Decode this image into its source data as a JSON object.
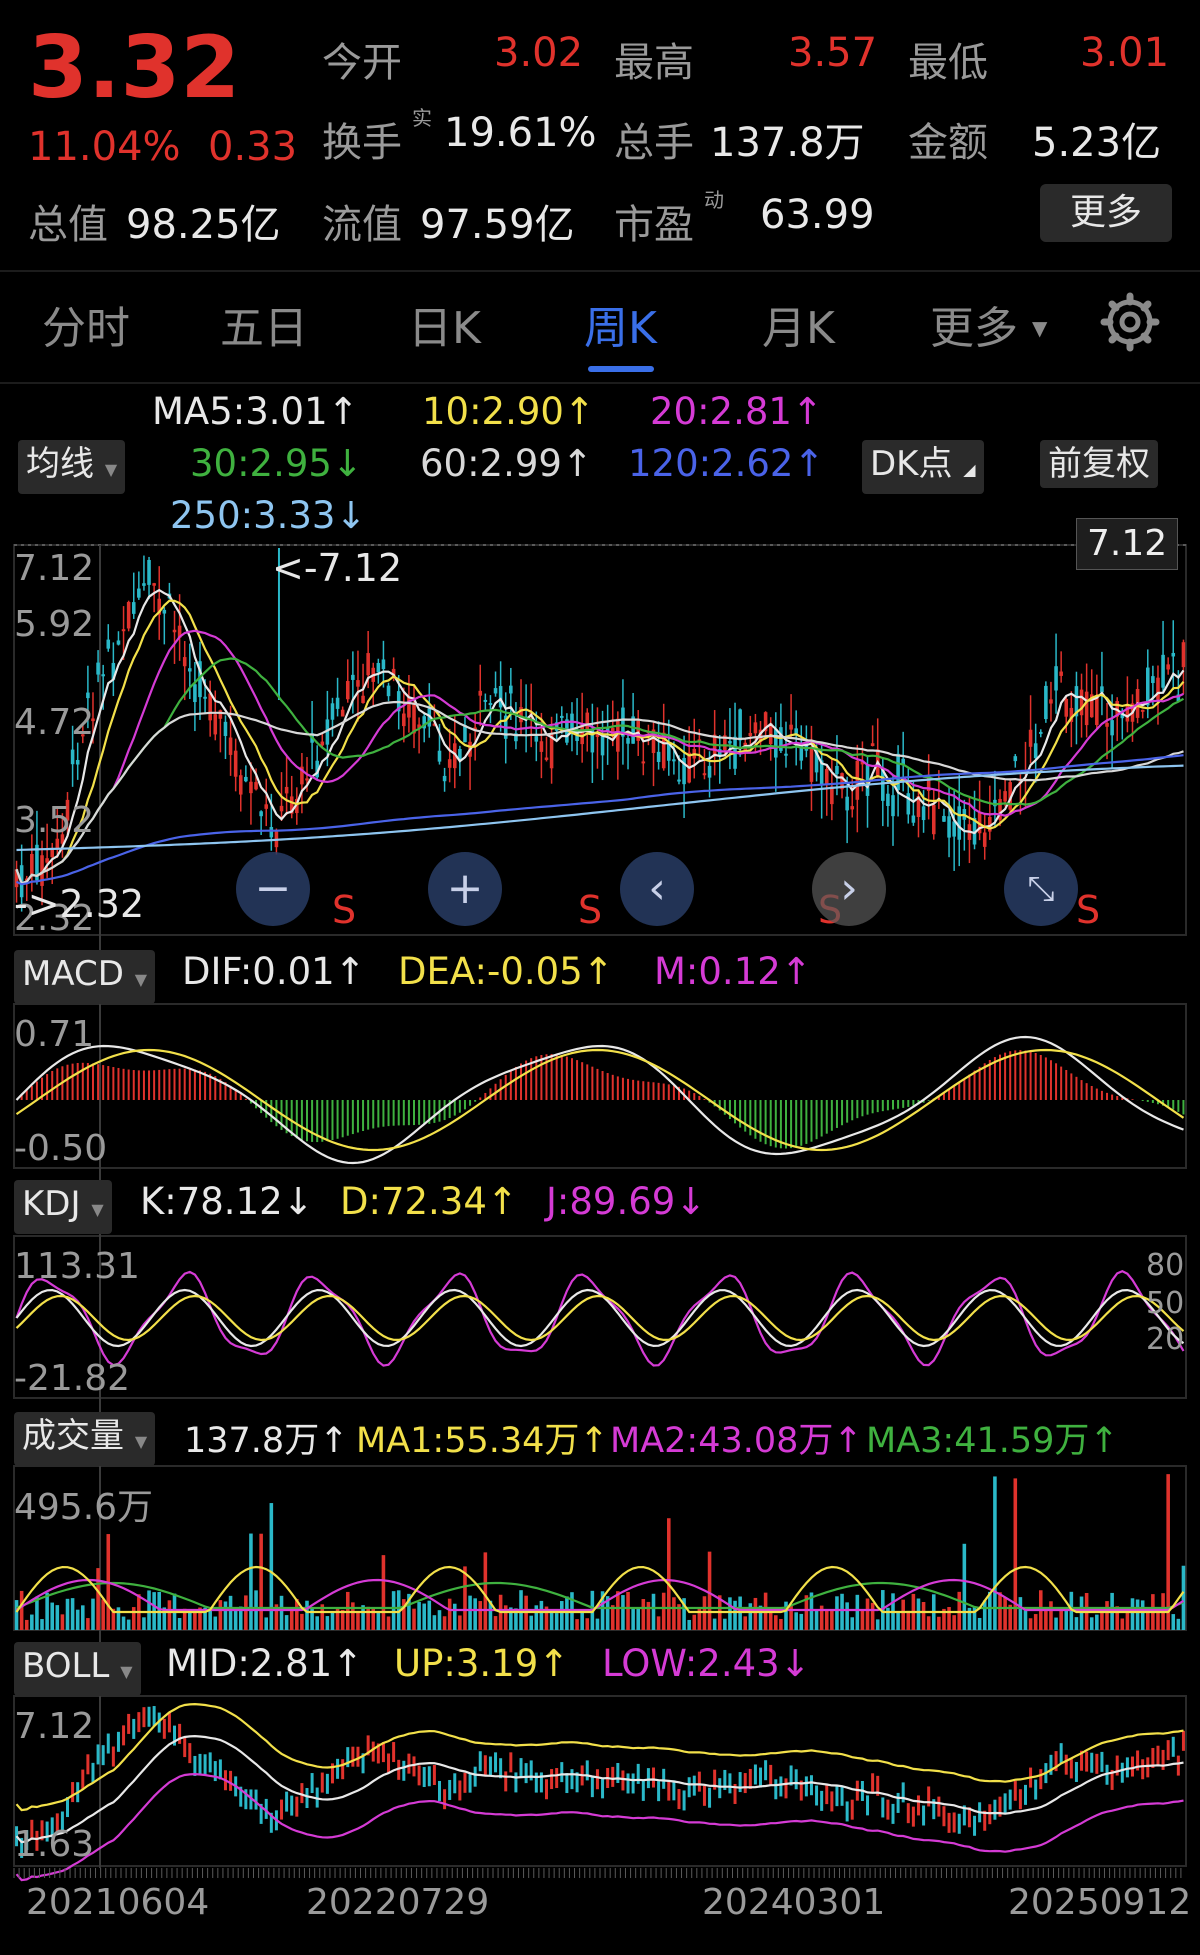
{
  "quote": {
    "price": "3.32",
    "change_pct": "11.04%",
    "change_abs": "0.33",
    "fields": [
      {
        "label": "今开",
        "value": "3.02"
      },
      {
        "label": "最高",
        "value": "3.57"
      },
      {
        "label": "最低",
        "value": "3.01"
      },
      {
        "label": "换手",
        "sup": "实",
        "value": "19.61%"
      },
      {
        "label": "总手",
        "value": "137.8万"
      },
      {
        "label": "金额",
        "value": "5.23亿"
      },
      {
        "label": "总值",
        "value": "98.25亿"
      },
      {
        "label": "流值",
        "value": "97.59亿"
      },
      {
        "label": "市盈",
        "sup": "动",
        "value": "63.99"
      }
    ],
    "more_label": "更多"
  },
  "tabs": [
    "分时",
    "五日",
    "日K",
    "周K",
    "月K",
    "更多"
  ],
  "active_tab": "周K",
  "ma": {
    "selector_label": "均线",
    "dk_label": "DK点",
    "fuquan_label": "前复权",
    "items": [
      {
        "text": "MA5:3.01↑",
        "color": "#e8e8e8"
      },
      {
        "text": "10:2.90↑",
        "color": "#f2e04a"
      },
      {
        "text": "20:2.81↑",
        "color": "#d53bd5"
      },
      {
        "text": "30:2.95↓",
        "color": "#3fb13f"
      },
      {
        "text": "60:2.99↑",
        "color": "#d8d8d8"
      },
      {
        "text": "120:2.62↑",
        "color": "#4a63e8"
      },
      {
        "text": "250:3.33↓",
        "color": "#8ec5f0"
      }
    ]
  },
  "main_chart": {
    "y_labels": [
      "7.12",
      "5.92",
      "4.72",
      "3.52",
      "2.32"
    ],
    "high_flag": "7.12",
    "high_marker": "<-7.12",
    "low_marker": "->2.32",
    "s_marker": "S"
  },
  "macd": {
    "selector_label": "MACD",
    "items": [
      {
        "text": "DIF:0.01↑",
        "color": "#e8e8e8"
      },
      {
        "text": "DEA:-0.05↑",
        "color": "#f2e04a"
      },
      {
        "text": "M:0.12↑",
        "color": "#d53bd5"
      }
    ],
    "y_labels": [
      "0.71",
      "-0.50"
    ]
  },
  "kdj": {
    "selector_label": "KDJ",
    "items": [
      {
        "text": "K:78.12↓",
        "color": "#e8e8e8"
      },
      {
        "text": "D:72.34↑",
        "color": "#f2e04a"
      },
      {
        "text": "J:89.69↓",
        "color": "#d53bd5"
      }
    ],
    "y_labels": [
      "113.31",
      "-21.82"
    ],
    "right_labels": [
      "80",
      "50",
      "20"
    ]
  },
  "volume": {
    "selector_label": "成交量",
    "items": [
      {
        "text": "137.8万↑",
        "color": "#e8e8e8"
      },
      {
        "text": "MA1:55.34万↑",
        "color": "#f2e04a"
      },
      {
        "text": "MA2:43.08万↑",
        "color": "#d53bd5"
      },
      {
        "text": "MA3:41.59万↑",
        "color": "#3fb13f"
      }
    ],
    "y_label": "495.6万"
  },
  "boll": {
    "selector_label": "BOLL",
    "items": [
      {
        "text": "MID:2.81↑",
        "color": "#e8e8e8"
      },
      {
        "text": "UP:3.19↑",
        "color": "#f2e04a"
      },
      {
        "text": "LOW:2.43↓",
        "color": "#d53bd5"
      }
    ],
    "y_labels": [
      "7.12",
      "1.63"
    ]
  },
  "x_axis": [
    "20210604",
    "20220729",
    "20240301",
    "20250912"
  ],
  "colors": {
    "up": "#e0322c",
    "down": "#2ab8c8",
    "active_tab": "#3a6fe8"
  }
}
